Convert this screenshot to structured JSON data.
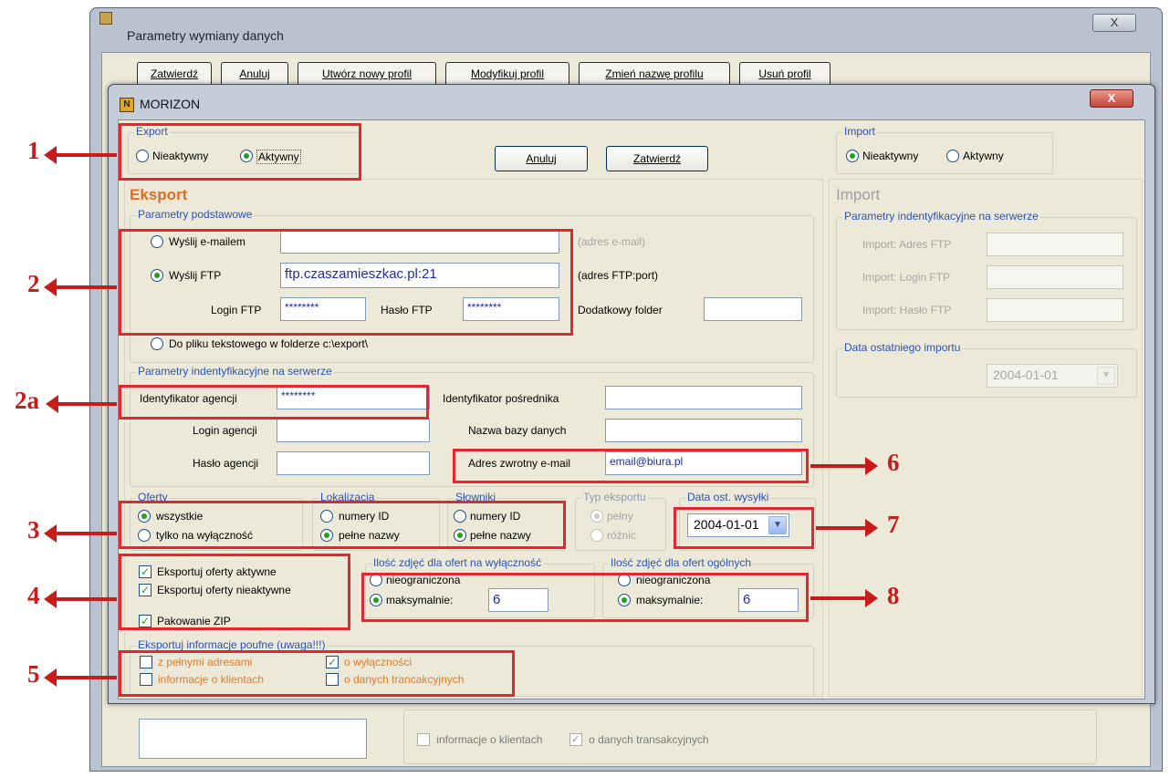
{
  "bg_window": {
    "title": "Parametry wymiany danych",
    "close_label": "X",
    "buttons": [
      "Zatwierdź",
      "Anuluj",
      "Utwórz nowy profil",
      "Modyfikuj profil",
      "Zmień nazwę profilu",
      "Usuń profil"
    ],
    "check_informacje": "informacje o klientach",
    "check_transakcyjnych": "o danych transakcyjnych"
  },
  "dialog": {
    "title": "MORIZON",
    "icon_text": "N",
    "close_label": "X",
    "cancel_label": "Anuluj",
    "confirm_label": "Zatwierdź"
  },
  "export_toggle": {
    "title": "Export",
    "inactive": "Nieaktywny",
    "active": "Aktywny",
    "selected": "Aktywny"
  },
  "import_toggle": {
    "title": "Import",
    "inactive": "Nieaktywny",
    "active": "Aktywny",
    "selected": "Nieaktywny"
  },
  "eksport": {
    "heading": "Eksport",
    "basic": {
      "title": "Parametry podstawowe",
      "send_email": "Wyślij e-mailem",
      "email_value": "",
      "email_hint": "(adres e-mail)",
      "send_ftp": "Wyślij FTP",
      "ftp_value": "ftp.czaszamieszkac.pl:21",
      "ftp_hint": "(adres FTP:port)",
      "login_ftp_label": "Login FTP",
      "login_ftp_value": "********",
      "password_ftp_label": "Hasło FTP",
      "password_ftp_value": "********",
      "extra_folder_label": "Dodatkowy folder",
      "extra_folder_value": "",
      "to_file": "Do pliku tekstowego w folderze c:\\export\\"
    },
    "ident": {
      "title": "Parametry indentyfikacyjne na serwerze",
      "agency_id_label": "Identyfikator agencji",
      "agency_id_value": "********",
      "agency_login_label": "Login agencji",
      "agency_password_label": "Hasło agencji",
      "broker_id_label": "Identyfikator pośrednika",
      "db_name_label": "Nazwa bazy danych",
      "return_email_label": "Adres zwrotny e-mail",
      "return_email_value": "email@biura.pl"
    },
    "oferty": {
      "title": "Oferty",
      "all": "wszystkie",
      "exclusive": "tylko na wyłączność"
    },
    "lokalizacja": {
      "title": "Lokalizacja",
      "ids": "numery ID",
      "names": "pełne nazwy"
    },
    "slowniki": {
      "title": "Słowniki",
      "ids": "numery ID",
      "names": "pełne nazwy"
    },
    "typ": {
      "title": "Typ eksportu",
      "full": "pełny",
      "partial": "różnic"
    },
    "data_wysylki": {
      "title": "Data ost. wysyłki",
      "value": "2004-01-01"
    },
    "checks": {
      "active_offers": "Eksportuj oferty aktywne",
      "inactive_offers": "Eksportuj oferty nieaktywne",
      "zip": "Pakowanie ZIP"
    },
    "photos_exclusive": {
      "title": "Ilość zdjęć dla ofert na wyłączność",
      "unlimited": "nieograniczona",
      "max": "maksymalnie:",
      "value": "6"
    },
    "photos_general": {
      "title": "Ilość zdjęć dla ofert ogólnych",
      "unlimited": "nieograniczona",
      "max": "maksymalnie:",
      "value": "6"
    },
    "confidential": {
      "title": "Eksportuj informacje poufne (uwaga!!!)",
      "full_addresses": "z pełnymi adresami",
      "exclusivity": "o wyłączności",
      "client_info": "informacje o klientach",
      "transaction_info": "o danych trancakcyjnych"
    }
  },
  "import_panel": {
    "heading": "Import",
    "group_title": "Parametry indentyfikacyjne na serwerze",
    "ftp_address": "Import: Adres FTP",
    "ftp_login": "Import: Login FTP",
    "ftp_password": "Import: Hasło FTP",
    "last_import_title": "Data ostatniego importu",
    "last_import_value": "2004-01-01"
  },
  "annotations": [
    "1",
    "2",
    "2a",
    "3",
    "4",
    "5",
    "6",
    "7",
    "8"
  ],
  "colors": {
    "annotation_red": "#e8242d",
    "section_orange": "#e26b20",
    "group_title_blue": "#2a52be",
    "radio_green": "#21a121"
  }
}
